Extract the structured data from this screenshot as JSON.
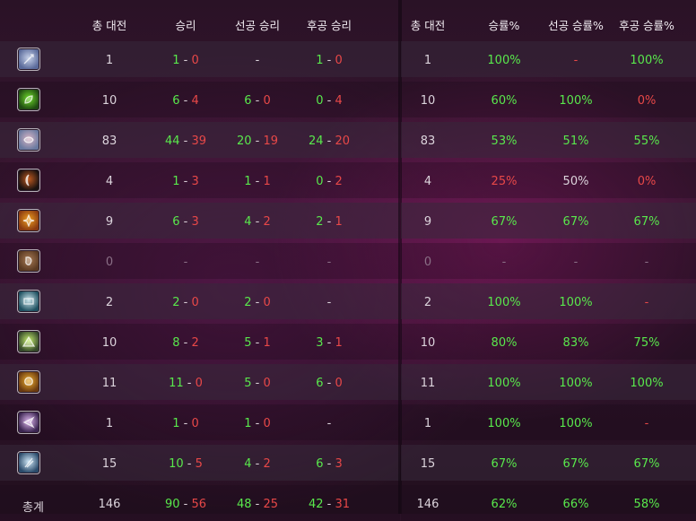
{
  "left_headers": [
    "총 대전",
    "승리",
    "선공 승리",
    "후공 승리"
  ],
  "right_headers": [
    "총 대전",
    "승률%",
    "선공 승률%",
    "후공 승률%"
  ],
  "rows": [
    {
      "icon": "mage-hero-icon",
      "total": "1",
      "wins": {
        "w": "1",
        "l": "0"
      },
      "first": null,
      "second": {
        "w": "1",
        "l": "0"
      },
      "rate": "100%",
      "first_rate": "-",
      "second_rate": "100%",
      "rate_c": "g",
      "first_rate_c": "r",
      "second_rate_c": "g"
    },
    {
      "icon": "hunter-hero-icon",
      "total": "10",
      "wins": {
        "w": "6",
        "l": "4"
      },
      "first": {
        "w": "6",
        "l": "0"
      },
      "second": {
        "w": "0",
        "l": "4"
      },
      "rate": "60%",
      "first_rate": "100%",
      "second_rate": "0%",
      "rate_c": "g",
      "first_rate_c": "g",
      "second_rate_c": "r"
    },
    {
      "icon": "druid-hero-icon",
      "total": "83",
      "wins": {
        "w": "44",
        "l": "39"
      },
      "first": {
        "w": "20",
        "l": "19"
      },
      "second": {
        "w": "24",
        "l": "20"
      },
      "rate": "53%",
      "first_rate": "51%",
      "second_rate": "55%",
      "rate_c": "g",
      "first_rate_c": "g",
      "second_rate_c": "g"
    },
    {
      "icon": "rogue-hero-icon",
      "total": "4",
      "wins": {
        "w": "1",
        "l": "3"
      },
      "first": {
        "w": "1",
        "l": "1"
      },
      "second": {
        "w": "0",
        "l": "2"
      },
      "rate": "25%",
      "first_rate": "50%",
      "second_rate": "0%",
      "rate_c": "r",
      "first_rate_c": "w",
      "second_rate_c": "r"
    },
    {
      "icon": "warrior-hero-icon",
      "total": "9",
      "wins": {
        "w": "6",
        "l": "3"
      },
      "first": {
        "w": "4",
        "l": "2"
      },
      "second": {
        "w": "2",
        "l": "1"
      },
      "rate": "67%",
      "first_rate": "67%",
      "second_rate": "67%",
      "rate_c": "g",
      "first_rate_c": "g",
      "second_rate_c": "g"
    },
    {
      "icon": "shaman-hero-icon",
      "total": "0",
      "wins": null,
      "first": null,
      "second": null,
      "rate": "-",
      "first_rate": "-",
      "second_rate": "-",
      "muted": true
    },
    {
      "icon": "paladin-hero-icon",
      "total": "2",
      "wins": {
        "w": "2",
        "l": "0"
      },
      "first": {
        "w": "2",
        "l": "0"
      },
      "second": null,
      "rate": "100%",
      "first_rate": "100%",
      "second_rate": "-",
      "rate_c": "g",
      "first_rate_c": "g",
      "second_rate_c": "r"
    },
    {
      "icon": "priest-hero-icon",
      "total": "10",
      "wins": {
        "w": "8",
        "l": "2"
      },
      "first": {
        "w": "5",
        "l": "1"
      },
      "second": {
        "w": "3",
        "l": "1"
      },
      "rate": "80%",
      "first_rate": "83%",
      "second_rate": "75%",
      "rate_c": "g",
      "first_rate_c": "g",
      "second_rate_c": "g"
    },
    {
      "icon": "warlock-hero-icon",
      "total": "11",
      "wins": {
        "w": "11",
        "l": "0"
      },
      "first": {
        "w": "5",
        "l": "0"
      },
      "second": {
        "w": "6",
        "l": "0"
      },
      "rate": "100%",
      "first_rate": "100%",
      "second_rate": "100%",
      "rate_c": "g",
      "first_rate_c": "g",
      "second_rate_c": "g"
    },
    {
      "icon": "demon-hunter-hero-icon",
      "total": "1",
      "wins": {
        "w": "1",
        "l": "0"
      },
      "first": {
        "w": "1",
        "l": "0"
      },
      "second": null,
      "rate": "100%",
      "first_rate": "100%",
      "second_rate": "-",
      "rate_c": "g",
      "first_rate_c": "g",
      "second_rate_c": "r"
    },
    {
      "icon": "frost-mage-hero-icon",
      "total": "15",
      "wins": {
        "w": "10",
        "l": "5"
      },
      "first": {
        "w": "4",
        "l": "2"
      },
      "second": {
        "w": "6",
        "l": "3"
      },
      "rate": "67%",
      "first_rate": "67%",
      "second_rate": "67%",
      "rate_c": "g",
      "first_rate_c": "g",
      "second_rate_c": "g"
    }
  ],
  "totals": {
    "label": "총계",
    "total": "146",
    "wins": {
      "w": "90",
      "l": "56"
    },
    "first": {
      "w": "48",
      "l": "25"
    },
    "second": {
      "w": "42",
      "l": "31"
    },
    "rate": "62%",
    "first_rate": "66%",
    "second_rate": "58%"
  },
  "colors": {
    "win": "#59e84c",
    "loss": "#e84848",
    "text": "#dcd4dc",
    "muted": "#8a6f86"
  },
  "icon_colors": {
    "mage-hero-icon": [
      "#5a6a9a",
      "#c9d3ea"
    ],
    "hunter-hero-icon": [
      "#1f4a12",
      "#6fdc2a"
    ],
    "druid-hero-icon": [
      "#6a7aa0",
      "#d8b4c4"
    ],
    "rogue-hero-icon": [
      "#1a1210",
      "#c05a20"
    ],
    "warrior-hero-icon": [
      "#8a3a10",
      "#f0a020"
    ],
    "shaman-hero-icon": [
      "#5a3a22",
      "#a87a55"
    ],
    "paladin-hero-icon": [
      "#1e5060",
      "#cfe8ee"
    ],
    "priest-hero-icon": [
      "#35482a",
      "#c8f070"
    ],
    "warlock-hero-icon": [
      "#6a3a10",
      "#f0b030"
    ],
    "demon-hunter-hero-icon": [
      "#3a2450",
      "#e0b8f0"
    ],
    "frost-mage-hero-icon": [
      "#2a4a6a",
      "#d0e8f8"
    ]
  }
}
